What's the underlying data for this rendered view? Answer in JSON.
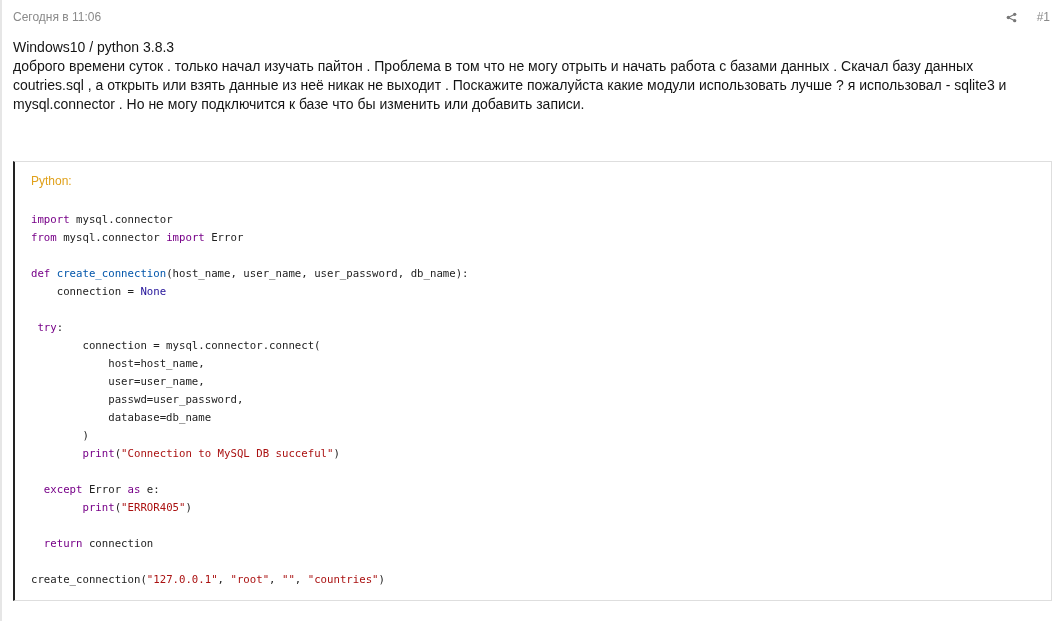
{
  "post": {
    "date": "Сегодня в 11:06",
    "number": "#1",
    "title": "Windows10 / python 3.8.3",
    "body": "доброго времени суток . только начал изучать пайтон . Проблема в том что не могу отрыть и начать работа с базами данных . Скачал базу данных coutries.sql , а открыть или взять данные из неё никак не выходит . Поскажите пожалуйста какие модули использовать лучше ? я использовал - sqlite3 и mysql.connector . Но не могу подключится к базе что бы изменить или добавить записи."
  },
  "code": {
    "language": "Python:",
    "blocks": [
      [
        {
          "tokens": [
            {
              "kind": "kw",
              "text": "import"
            },
            {
              "kind": "plain",
              "text": " mysql.connector"
            }
          ]
        },
        {
          "tokens": [
            {
              "kind": "kw",
              "text": "from"
            },
            {
              "kind": "plain",
              "text": " mysql.connector "
            },
            {
              "kind": "kw",
              "text": "import"
            },
            {
              "kind": "plain",
              "text": " Error"
            }
          ]
        }
      ],
      [
        {
          "tokens": [
            {
              "kind": "kw",
              "text": "def "
            },
            {
              "kind": "fn",
              "text": "create_connection"
            },
            {
              "kind": "plain",
              "text": "(host_name, user_name, user_password, db_name):"
            }
          ]
        },
        {
          "tokens": [
            {
              "kind": "plain",
              "text": "    connection = "
            },
            {
              "kind": "const",
              "text": "None"
            }
          ]
        }
      ],
      [
        {
          "tokens": [
            {
              "kind": "kw",
              "text": " try"
            },
            {
              "kind": "plain",
              "text": ":"
            }
          ]
        },
        {
          "tokens": [
            {
              "kind": "plain",
              "text": "        connection = mysql.connector.connect("
            }
          ]
        },
        {
          "tokens": [
            {
              "kind": "plain",
              "text": "            host=host_name,"
            }
          ]
        },
        {
          "tokens": [
            {
              "kind": "plain",
              "text": "            user=user_name,"
            }
          ]
        },
        {
          "tokens": [
            {
              "kind": "plain",
              "text": "            passwd=user_password,"
            }
          ]
        },
        {
          "tokens": [
            {
              "kind": "plain",
              "text": "            database=db_name"
            }
          ]
        },
        {
          "tokens": [
            {
              "kind": "plain",
              "text": "        )"
            }
          ]
        },
        {
          "tokens": [
            {
              "kind": "kw",
              "text": "        print"
            },
            {
              "kind": "plain",
              "text": "("
            },
            {
              "kind": "str",
              "text": "\"Connection to MySQL DB succeful\""
            },
            {
              "kind": "plain",
              "text": ")"
            }
          ]
        }
      ],
      [
        {
          "tokens": [
            {
              "kind": "kw",
              "text": "  except"
            },
            {
              "kind": "plain",
              "text": " Error "
            },
            {
              "kind": "kw",
              "text": "as"
            },
            {
              "kind": "plain",
              "text": " e:"
            }
          ]
        },
        {
          "tokens": [
            {
              "kind": "kw",
              "text": "        print"
            },
            {
              "kind": "plain",
              "text": "("
            },
            {
              "kind": "str",
              "text": "\"ERROR405\""
            },
            {
              "kind": "plain",
              "text": ")"
            }
          ]
        }
      ],
      [
        {
          "tokens": [
            {
              "kind": "kw",
              "text": "  return"
            },
            {
              "kind": "plain",
              "text": " connection"
            }
          ]
        }
      ],
      [
        {
          "tokens": [
            {
              "kind": "plain",
              "text": "create_connection("
            },
            {
              "kind": "str",
              "text": "\"127.0.0.1\""
            },
            {
              "kind": "plain",
              "text": ", "
            },
            {
              "kind": "str",
              "text": "\"root\""
            },
            {
              "kind": "plain",
              "text": ", "
            },
            {
              "kind": "str",
              "text": "\"\""
            },
            {
              "kind": "plain",
              "text": ", "
            },
            {
              "kind": "str",
              "text": "\"countries\""
            },
            {
              "kind": "plain",
              "text": ")"
            }
          ]
        }
      ]
    ]
  }
}
